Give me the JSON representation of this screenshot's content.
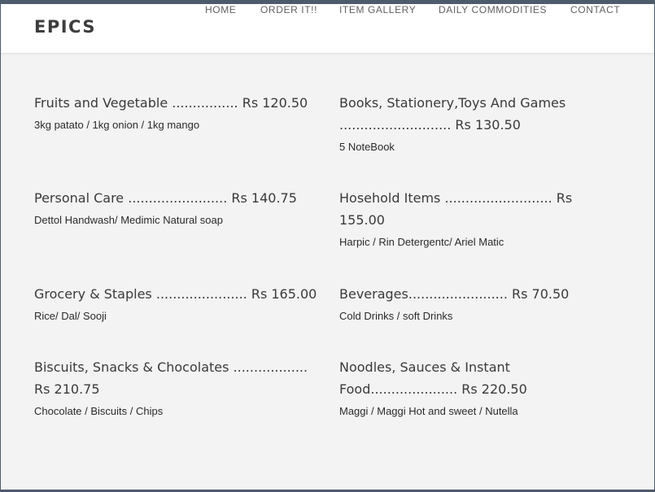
{
  "brand": "EPICS",
  "nav": {
    "home": "HOME",
    "order": "ORDER IT!!",
    "gallery": "ITEM GALLERY",
    "daily": "DAILY COMMODITIES",
    "contact": "CONTACT"
  },
  "items": [
    {
      "title": "Fruits and Vegetable ................ Rs 120.50",
      "desc": "3kg patato / 1kg onion / 1kg mango"
    },
    {
      "title": "Books, Stationery,Toys And Games ........................... Rs 130.50",
      "desc": "5 NoteBook"
    },
    {
      "title": "Personal Care ........................ Rs 140.75",
      "desc": "Dettol Handwash/ Medimic Natural soap"
    },
    {
      "title": "Hosehold Items .......................... Rs 155.00",
      "desc": "Harpic / Rin Detergentc/ Ariel Matic"
    },
    {
      "title": "Grocery & Staples ...................... Rs 165.00",
      "desc": "Rice/ Dal/ Sooji"
    },
    {
      "title": "Beverages........................ Rs 70.50",
      "desc": "Cold Drinks / soft Drinks"
    },
    {
      "title": "Biscuits, Snacks & Chocolates .................. Rs 210.75",
      "desc": "Chocolate / Biscuits / Chips"
    },
    {
      "title": "Noodles, Sauces & Instant Food..................... Rs 220.50",
      "desc": "Maggi / Maggi Hot and sweet / Nutella"
    }
  ]
}
